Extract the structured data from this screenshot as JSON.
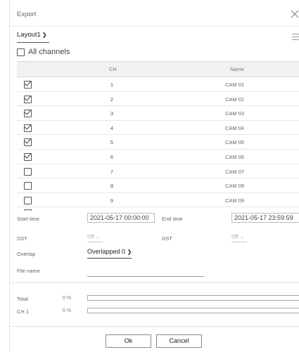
{
  "dialog": {
    "title": "Export"
  },
  "layout": {
    "selected": "Layout1"
  },
  "all_channels_label": "All channels",
  "table": {
    "headers": {
      "ch": "CH",
      "name": "Name"
    },
    "rows": [
      {
        "ch": "1",
        "name": "CAM 01",
        "checked": true
      },
      {
        "ch": "2",
        "name": "CAM 02",
        "checked": true
      },
      {
        "ch": "3",
        "name": "CAM 03",
        "checked": true
      },
      {
        "ch": "4",
        "name": "CAM 04",
        "checked": true
      },
      {
        "ch": "5",
        "name": "CAM 05",
        "checked": true
      },
      {
        "ch": "6",
        "name": "CAM 06",
        "checked": true
      },
      {
        "ch": "7",
        "name": "CAM 07",
        "checked": false
      },
      {
        "ch": "8",
        "name": "CAM 08",
        "checked": false
      },
      {
        "ch": "9",
        "name": "CAM 09",
        "checked": false
      }
    ]
  },
  "form": {
    "start_time_label": "Start time",
    "start_time_value": "2021-05-17 00:00:00",
    "end_time_label": "End time",
    "end_time_value": "2021-05-17 23:59:59",
    "dst_label": "DST",
    "dst_start_value": "Off",
    "dst_end_label": "DST",
    "dst_end_value": "Off",
    "overlap_label": "Overlap",
    "overlap_value": "Overlapped 0",
    "file_name_label": "File name",
    "file_name_value": ""
  },
  "progress": {
    "total_label": "Total",
    "total_pct_text": "0 %",
    "total_fraction": 0,
    "ch_label": "CH 1",
    "ch_pct_text": "0 %",
    "ch_fraction": 0
  },
  "buttons": {
    "ok": "Ok",
    "cancel": "Cancel"
  },
  "colors": {
    "accent": "#4a7ac9",
    "border": "#bbbbbb",
    "header_bg": "#f1f1f1"
  }
}
